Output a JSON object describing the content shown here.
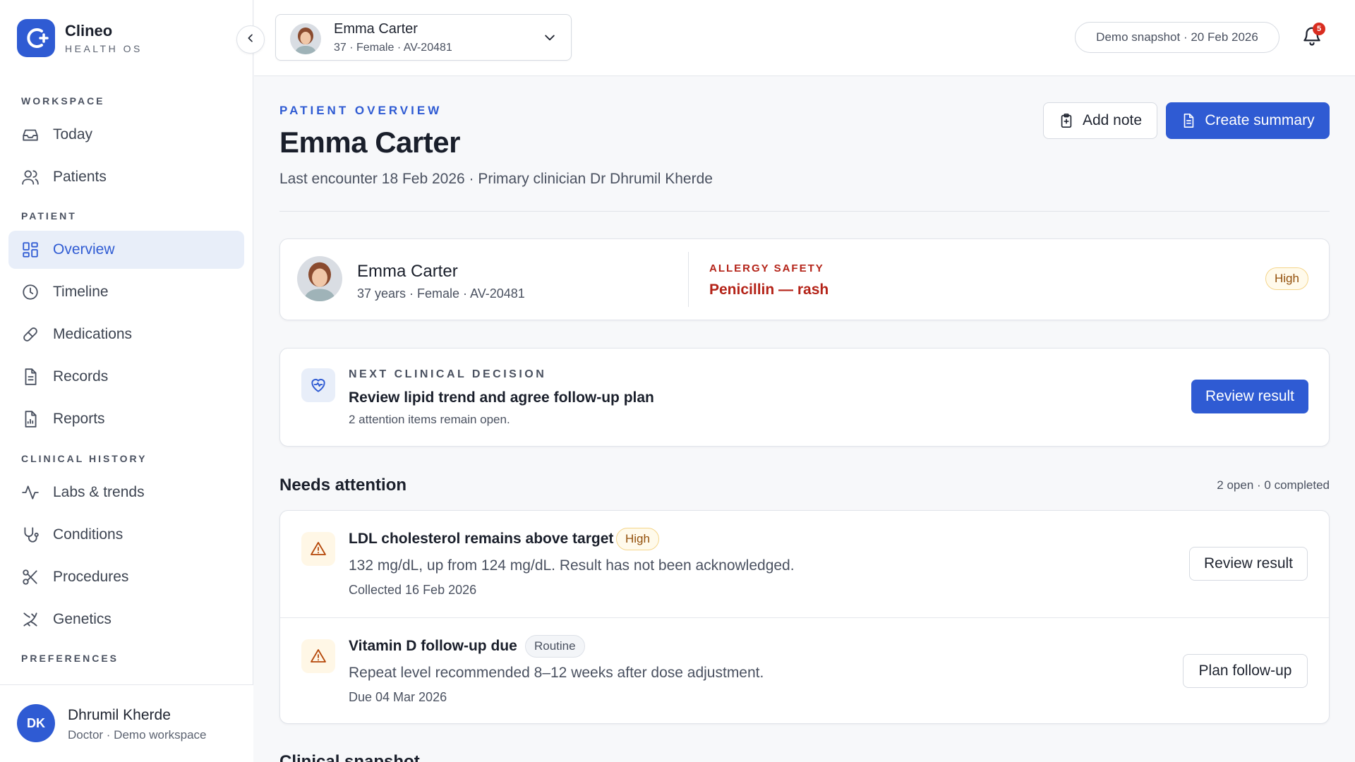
{
  "brand": {
    "name": "Clineo",
    "subtitle": "HEALTH OS"
  },
  "sidebar": {
    "sections": {
      "workspace": "WORKSPACE",
      "patient": "PATIENT",
      "clinical_history": "CLINICAL HISTORY",
      "preferences": "PREFERENCES"
    },
    "items": [
      {
        "label": "Today",
        "icon": "inbox-icon"
      },
      {
        "label": "Patients",
        "icon": "users-icon"
      },
      {
        "label": "Overview",
        "icon": "grid-icon",
        "active": true
      },
      {
        "label": "Timeline",
        "icon": "clock-icon"
      },
      {
        "label": "Medications",
        "icon": "pill-icon"
      },
      {
        "label": "Records",
        "icon": "document-icon"
      },
      {
        "label": "Reports",
        "icon": "report-icon"
      },
      {
        "label": "Labs & trends",
        "icon": "activity-icon"
      },
      {
        "label": "Conditions",
        "icon": "stethoscope-icon"
      },
      {
        "label": "Procedures",
        "icon": "scissors-icon"
      },
      {
        "label": "Genetics",
        "icon": "dna-icon"
      }
    ],
    "user": {
      "initials": "DK",
      "name": "Dhrumil Kherde",
      "role": "Doctor · Demo workspace"
    }
  },
  "topbar": {
    "patient_select": {
      "name": "Emma Carter",
      "meta": "37 · Female · AV-20481"
    },
    "demo_snapshot": "Demo snapshot · 20 Feb 2026",
    "notifications_count": "5"
  },
  "header": {
    "eyebrow": "PATIENT OVERVIEW",
    "title": "Emma Carter",
    "subtitle": "Last encounter 18 Feb 2026 · Primary clinician Dr Dhrumil Kherde",
    "add_note": "Add note",
    "create_summary": "Create summary"
  },
  "patient_card": {
    "name": "Emma Carter",
    "meta": "37 years · Female · AV-20481",
    "allergy_label": "ALLERGY SAFETY",
    "allergy": "Penicillin — rash",
    "severity": "High"
  },
  "decision": {
    "label": "NEXT CLINICAL DECISION",
    "title": "Review lipid trend and agree follow-up plan",
    "sub": "2 attention items remain open.",
    "action": "Review result"
  },
  "attention": {
    "heading": "Needs attention",
    "summary": "2 open · 0 completed",
    "items": [
      {
        "title": "LDL cholesterol remains above target",
        "badge": "High",
        "desc": "132 mg/dL, up from 124 mg/dL. Result has not been acknowledged.",
        "date": "Collected 16 Feb 2026",
        "action": "Review result"
      },
      {
        "title": "Vitamin D follow-up due",
        "badge": "Routine",
        "desc": "Repeat level recommended 8–12 weeks after dose adjustment.",
        "date": "Due 04 Mar 2026",
        "action": "Plan follow-up"
      }
    ]
  },
  "next_section": "Clinical snapshot",
  "colors": {
    "accent": "#2f5bd3",
    "danger": "#b42318",
    "warning": "#93500b"
  }
}
